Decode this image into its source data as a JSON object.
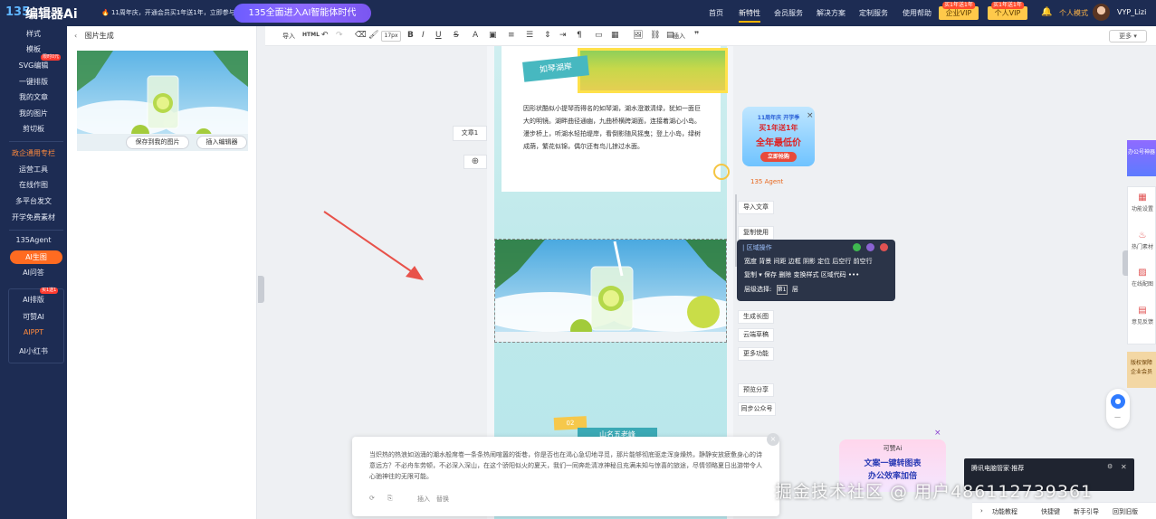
{
  "header": {
    "logo_num": "135",
    "logo_text": "编辑器Ai",
    "announcement": "🔥 11周年庆，开通会员买1年送1年，立即参与",
    "promo": "135全面进入AI智能体时代",
    "nav": [
      "首页",
      "新特性",
      "会员服务",
      "解决方案",
      "定制服务",
      "使用帮助"
    ],
    "enterprise_vip": "企业VIP",
    "enterprise_vip_tag": "买1年送1年",
    "personal_vip": "个人VIP",
    "personal_vip_tag": "买1年送1年",
    "personal_mode": "个人模式",
    "username": "VYP_Lizi"
  },
  "sidebar": {
    "items_top": [
      "样式",
      "模板",
      "SVG编辑",
      "一键排版",
      "我的文章",
      "我的图片",
      "剪切板"
    ],
    "svg_badge": "限时0元",
    "section_label": "政企通用专栏",
    "items_mid": [
      "运营工具",
      "在线作图",
      "多平台发文",
      "开学免费素材"
    ],
    "agent": "135Agent",
    "ai_gen": "AI生图",
    "ai_qa": "AI问答",
    "ai_layout": "AI排版",
    "ai_layout_badge": "买1送1",
    "items_ai": [
      "可赞AI",
      "AIPPT",
      "AI小红书"
    ]
  },
  "panel": {
    "back_label": "图片生成",
    "save_button": "保存到我的图片",
    "insert_button": "插入编辑器"
  },
  "toolbar": {
    "import": "导入",
    "html": "HTML",
    "font_size": "17px",
    "insert": "插入",
    "more": "更多"
  },
  "editor": {
    "doc_tab": "文章1",
    "plus": "⊕",
    "tag": "如琴湖岸",
    "body": "因形状酷似小提琴而得名的如琴湖，湖水澄澈清绿，犹如一面巨大的明镜。湖畔曲径通幽，九曲桥横跨湖面，连接着湖心小岛。漫步桥上，听湖水轻拍堤岸，看倒影随风摇曳；登上小岛，绿树成荫，繁花似锦，偶尔还有鸟儿掠过水面。",
    "sign_num": "02",
    "sign_title": "山名五老峰"
  },
  "popup": {
    "text": "当炽热的热浪如汹涌的潮水般席卷一条条热闹喧嚣的街巷，你是否也在渴心急切地寻觅，那片能够彻底驱走浑身燥热，静静安放疲惫身心的诗意远方？不必舟车劳顿，不必深入深山，在这个骄阳似火的夏天，我们一同奔赴清凉神秘且充满未知与惊喜的旅途，尽情领略夏日出游带令人心驰神往的无限可能。",
    "insert": "插入",
    "replace": "替换"
  },
  "side_actions": [
    "导入文章",
    "复制使用",
    "生成长图",
    "云端草稿",
    "更多功能",
    "预览分享",
    "同步公众号"
  ],
  "block_panel": {
    "title": "| 区域操作",
    "row1": [
      "宽度",
      "背景",
      "间距",
      "边框",
      "阴影",
      "定位",
      "后空行",
      "前空行"
    ],
    "row2": [
      "复制",
      "▾",
      "保存",
      "删除",
      "变换样式",
      "区域代码",
      "•••"
    ],
    "level_label": "层级选择:",
    "level_value": "第1",
    "level_suffix": "层"
  },
  "ad": {
    "top": "11周年庆 开学季",
    "middle": "买1年送1年",
    "main": "全年最低价",
    "button": "立即抢购",
    "agent_link": "135 Agent"
  },
  "right_rail": {
    "top_promo": "办公号神器",
    "items": [
      "功能设置",
      "热门素材",
      "在线配图",
      "意见反馈"
    ],
    "bottom_promo": [
      "版权保障",
      "企业会员"
    ]
  },
  "kedan_ad": {
    "brand": "可赞Ai",
    "line1": "文案一键转图表",
    "line2": "办公效率加倍"
  },
  "notify": {
    "title": "腾讯电脑管家·推荐"
  },
  "bottom_bar": [
    "功能教程",
    "快捷键",
    "新手引导",
    "回到旧版"
  ],
  "watermark": "掘金技术社区 @ 用户4861127393​61"
}
